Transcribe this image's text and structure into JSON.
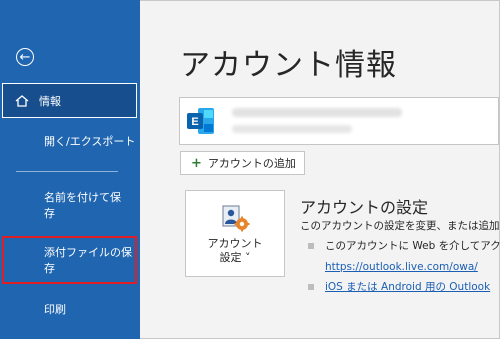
{
  "sidebar": {
    "back_glyph": "←",
    "items": [
      {
        "label": "情報",
        "icon": "home-icon"
      },
      {
        "label": "開く/エクスポート"
      },
      {
        "label": "名前を付けて保存"
      },
      {
        "label": "添付ファイルの保存"
      },
      {
        "label": "印刷"
      }
    ],
    "save_as_line1": "名前を付けて保",
    "save_as_line2": "存"
  },
  "main": {
    "title": "アカウント情報",
    "account_logo_letter": "E",
    "add_account_label": "アカウントの追加",
    "settings_tile": {
      "line1": "アカウント",
      "line2": "設定 ˅"
    },
    "settings_heading": "アカウントの設定",
    "settings_desc": "このアカウントの設定を変更、または追加の",
    "bullet1": "このアカウントに Web を介してアクセス",
    "bullet1_link": "https://outlook.live.com/owa/",
    "bullet2_link": "iOS または Android 用の Outlook"
  },
  "colors": {
    "sidebar": "#1f65b0",
    "sidebar_selected": "#174f8e",
    "highlight_border": "#e01e24",
    "link": "#1a5fb4"
  }
}
